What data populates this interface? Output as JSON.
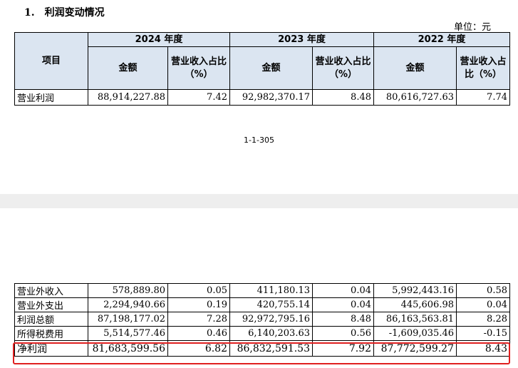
{
  "section": {
    "number": "1.",
    "title": "利润变动情况"
  },
  "unit_label": "单位：元",
  "table_header": {
    "item_label": "项目",
    "years": [
      "2024 年度",
      "2023 年度",
      "2022 年度"
    ],
    "amount_label": "金额",
    "ratio_label": "营业收入占比（%）"
  },
  "top_rows": [
    {
      "item": "营业利润",
      "v2024": "88,914,227.88",
      "r2024": "7.42",
      "v2023": "92,982,370.17",
      "r2023": "8.48",
      "v2022": "80,616,727.63",
      "r2022": "7.74"
    }
  ],
  "page_number": "1-1-305",
  "bottom_rows": [
    {
      "item": "营业外收入",
      "v2024": "578,889.80",
      "r2024": "0.05",
      "v2023": "411,180.13",
      "r2023": "0.04",
      "v2022": "5,992,443.16",
      "r2022": "0.58"
    },
    {
      "item": "营业外支出",
      "v2024": "2,294,940.66",
      "r2024": "0.19",
      "v2023": "420,755.14",
      "r2023": "0.04",
      "v2022": "445,606.98",
      "r2022": "0.04"
    },
    {
      "item": "利润总额",
      "v2024": "87,198,177.02",
      "r2024": "7.28",
      "v2023": "92,972,795.16",
      "r2023": "8.48",
      "v2022": "86,163,563.81",
      "r2022": "8.28"
    },
    {
      "item": "所得税费用",
      "v2024": "5,514,577.46",
      "r2024": "0.46",
      "v2023": "6,140,203.63",
      "r2023": "0.56",
      "v2022": "-1,609,035.46",
      "r2022": "-0.15"
    },
    {
      "item": "净利润",
      "v2024": "81,683,599.56",
      "r2024": "6.82",
      "v2023": "86,832,591.53",
      "r2023": "7.92",
      "v2022": "87,772,599.27",
      "r2022": "8.43"
    }
  ],
  "colors": {
    "header_bg": "#dbe5f1",
    "highlight_border": "#e02020",
    "page_gap": "#eeeeee"
  }
}
